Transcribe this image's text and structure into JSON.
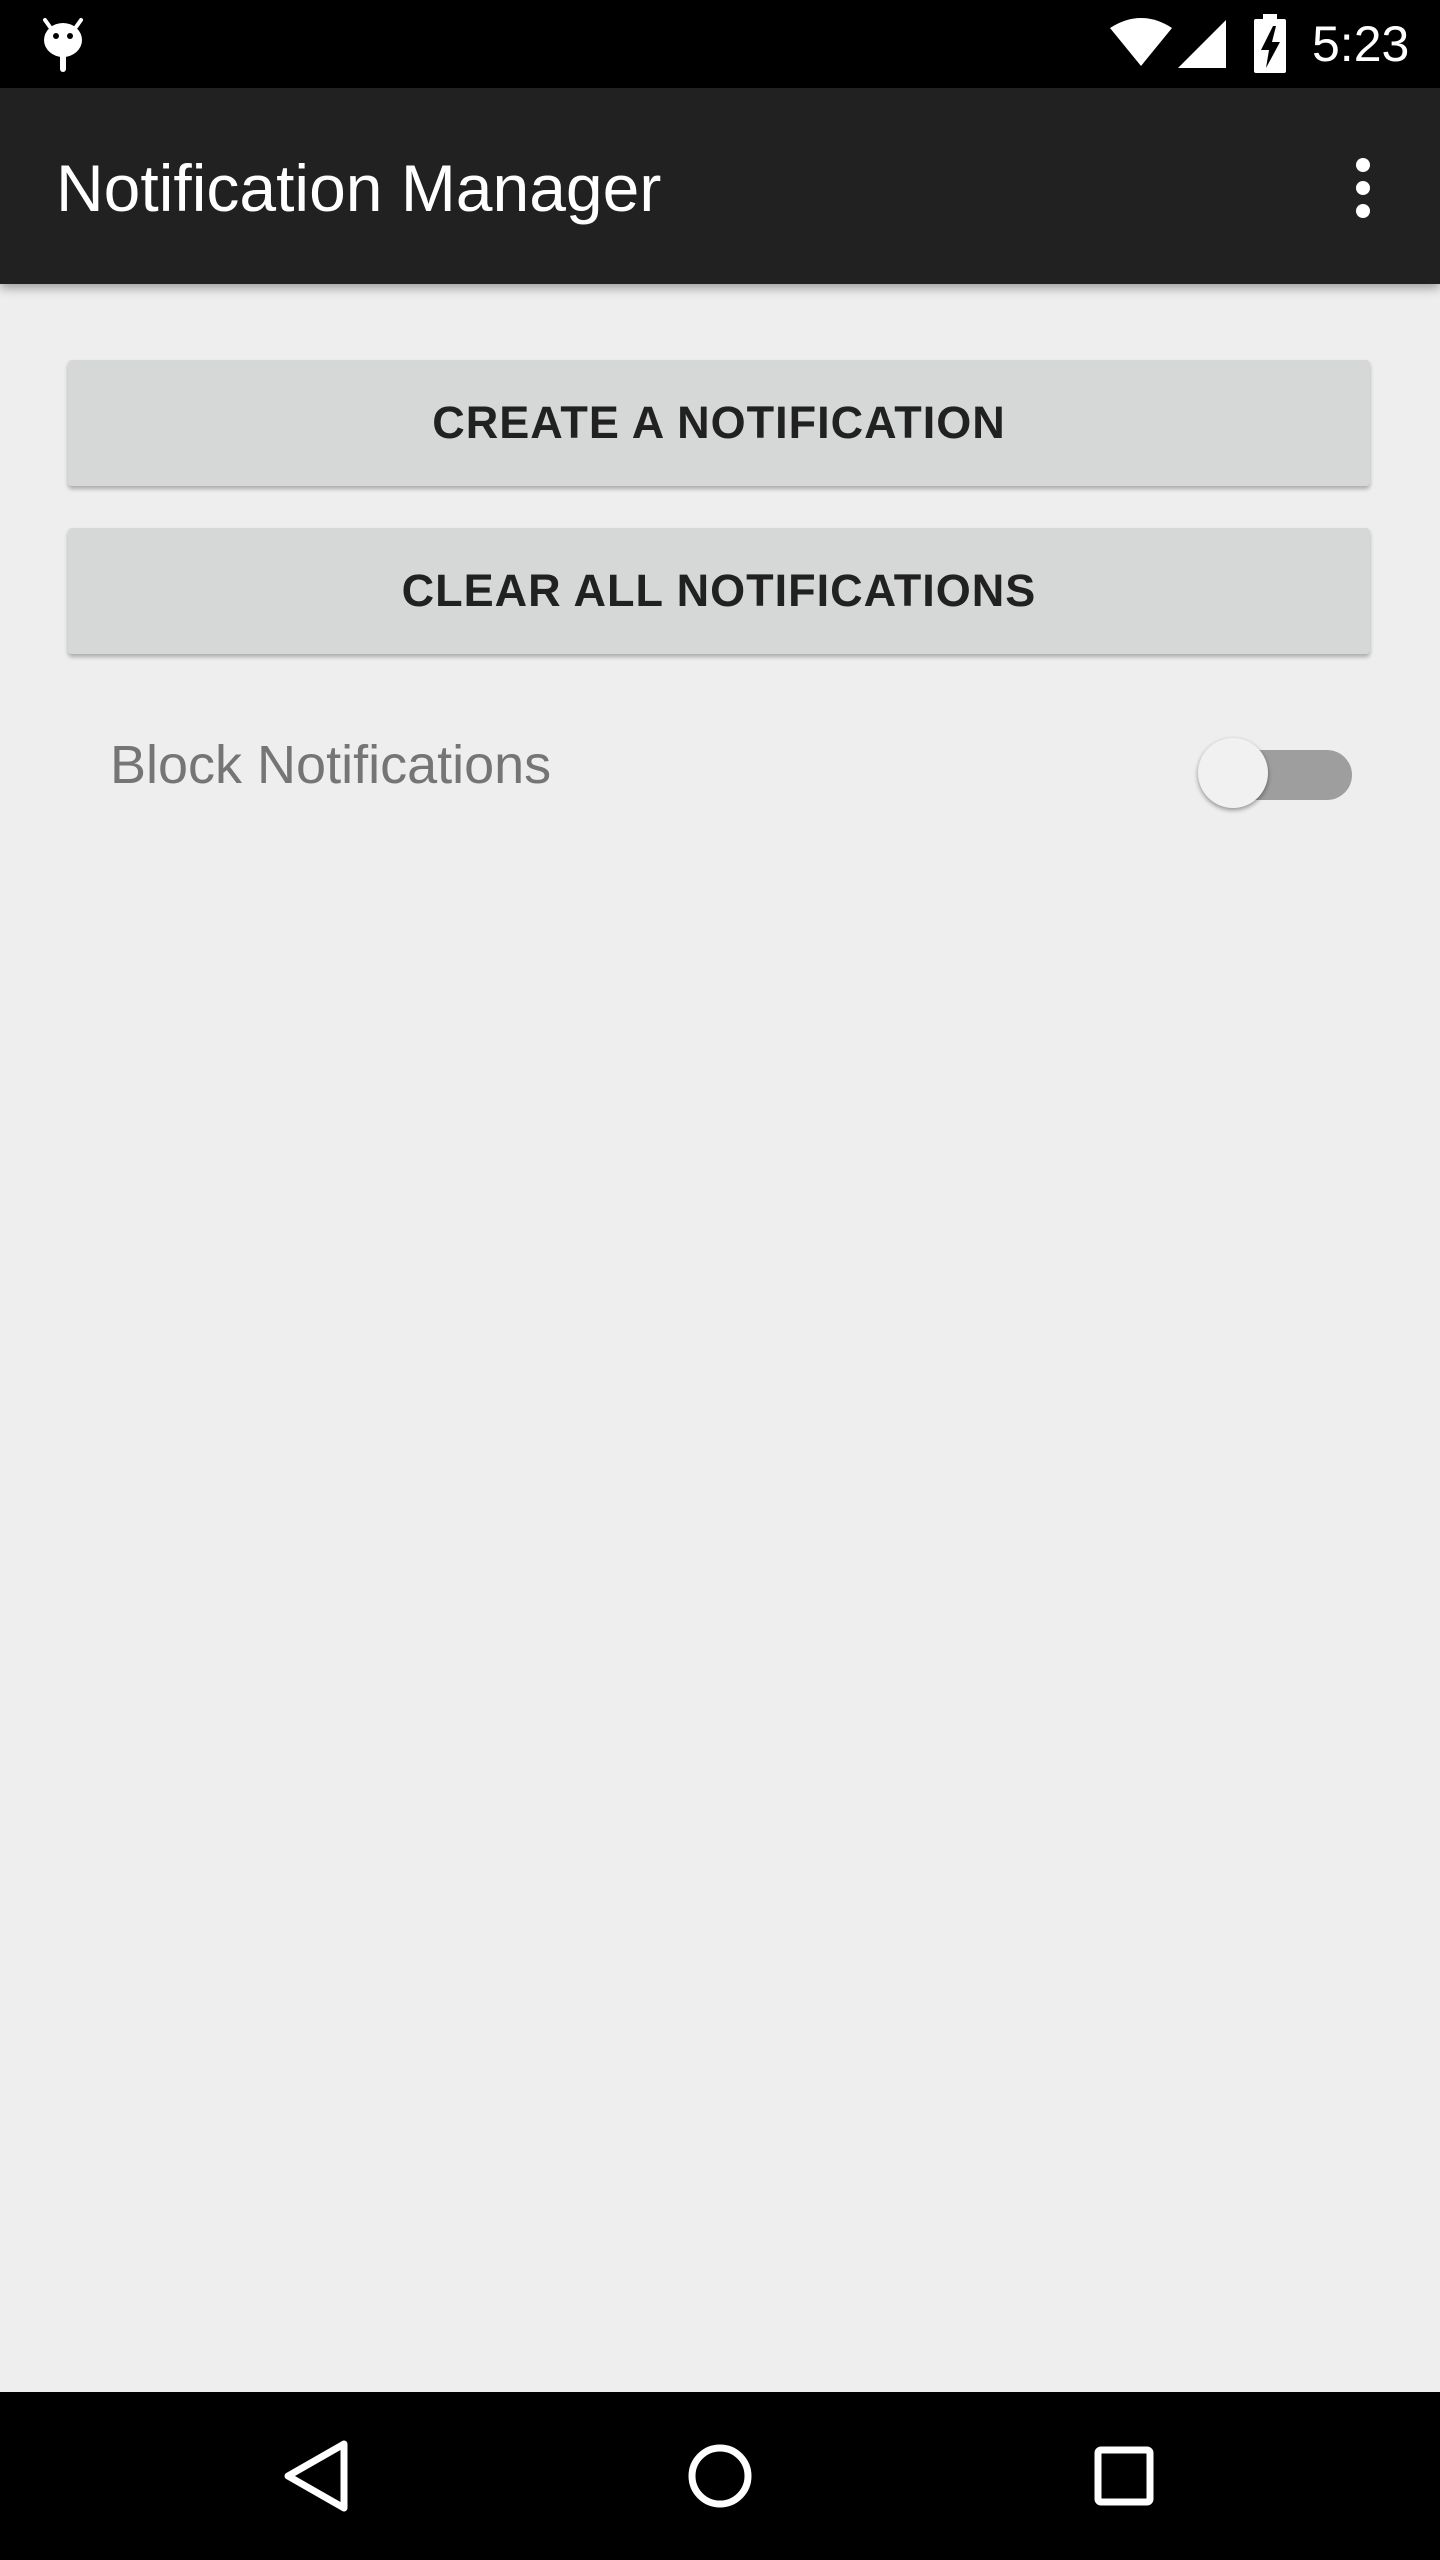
{
  "status_bar": {
    "time": "5:23",
    "icons": [
      "android-debug-icon",
      "wifi-icon",
      "cell-signal-icon",
      "battery-charging-icon"
    ]
  },
  "app_bar": {
    "title": "Notification Manager",
    "overflow_icon": "more-vert-icon"
  },
  "main": {
    "create_button_label": "CREATE A NOTIFICATION",
    "clear_button_label": "CLEAR ALL NOTIFICATIONS",
    "block_switch": {
      "label": "Block Notifications",
      "checked": false
    }
  },
  "nav_bar": {
    "icons": [
      "back-icon",
      "home-icon",
      "recents-icon"
    ]
  },
  "colors": {
    "status_bar": "#000000",
    "app_bar": "#212121",
    "background": "#eeeeee",
    "button": "#d6d7d7",
    "switch_track_off": "#9e9e9e",
    "switch_thumb_off": "#f1f1f1"
  }
}
